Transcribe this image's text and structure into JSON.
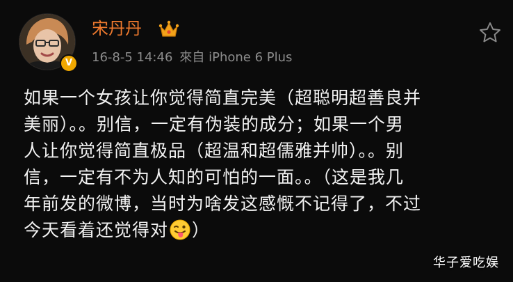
{
  "post": {
    "author": {
      "name": "宋丹丹",
      "avatar_icon": "avatar",
      "verified_icon": "verified-badge-icon",
      "verified_mark": "V",
      "member_icon": "crown-icon"
    },
    "meta": {
      "time": "16-8-5 14:46",
      "source": "來自 iPhone 6 Plus"
    },
    "favorite_icon": "star-icon",
    "content_lines": [
      "如果一个女孩让你觉得简直完美（超聪明超善良并",
      "美丽）。。别信，一定有伪装的成分；如果一个男",
      "人让你觉得简直极品（超温和超儒雅并帅）。。别",
      "信，一定有不为人知的可怕的一面。。（这是我几",
      "年前发的微博，当时为啥发这感慨不记得了，不过",
      "今天看着还觉得对"
    ],
    "content_tail": "）",
    "emoji_icon": "tongue-out-emoji-icon"
  },
  "watermark": "华子爱吃娱",
  "colors": {
    "background": "#0b0b0b",
    "username": "#f07a2e",
    "meta": "#8c8c8c",
    "text": "#f2f2f2",
    "verified": "#f0a800"
  }
}
